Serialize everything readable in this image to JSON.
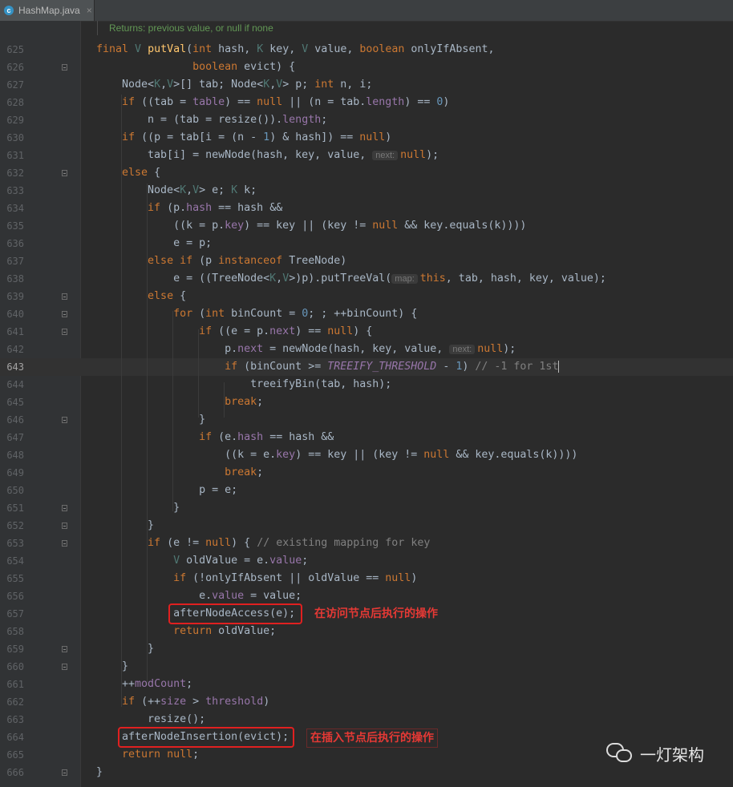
{
  "tab": {
    "title": "HashMap.java",
    "icon": "java-class-icon",
    "close": "×"
  },
  "doc_comment": "Returns: previous value, or null if none",
  "lines": [
    {
      "n": "625",
      "fold": false,
      "html": "<span class=\"kw\">final </span><span class=\"tp\">V</span> <span class=\"fn\">putVal</span>(<span class=\"kw\">int </span>hash, <span class=\"tp\">K</span> key, <span class=\"tp\">V</span> value, <span class=\"kw\">boolean </span>onlyIfAbsent,"
    },
    {
      "n": "626",
      "fold": true,
      "html": "               <span class=\"kw\">boolean </span>evict) {"
    },
    {
      "n": "627",
      "fold": false,
      "html": "    Node&lt;<span class=\"tp\">K</span>,<span class=\"tp\">V</span>&gt;[] tab; Node&lt;<span class=\"tp\">K</span>,<span class=\"tp\">V</span>&gt; p; <span class=\"kw\">int </span>n, i;"
    },
    {
      "n": "628",
      "fold": false,
      "html": "    <span class=\"kw\">if </span>((tab = <span class=\"fld\">table</span>) == <span class=\"kw\">null </span>|| (n = tab.<span class=\"fld\">length</span>) == <span class=\"num\">0</span>)"
    },
    {
      "n": "629",
      "fold": false,
      "html": "        n = (tab = resize()).<span class=\"fld\">length</span>;"
    },
    {
      "n": "630",
      "fold": false,
      "html": "    <span class=\"kw\">if </span>((p = tab[i = (n - <span class=\"num\">1</span>) &amp; hash]) == <span class=\"kw\">null</span>)"
    },
    {
      "n": "631",
      "fold": false,
      "html": "        tab[i] = newNode(hash, key, value, <span class=\"hint\">next:</span><span class=\"kw\">null</span>);"
    },
    {
      "n": "632",
      "fold": true,
      "html": "    <span class=\"kw\">else </span>{"
    },
    {
      "n": "633",
      "fold": false,
      "html": "        Node&lt;<span class=\"tp\">K</span>,<span class=\"tp\">V</span>&gt; e; <span class=\"tp\">K</span> k;"
    },
    {
      "n": "634",
      "fold": false,
      "html": "        <span class=\"kw\">if </span>(p.<span class=\"fld\">hash</span> == hash &amp;&amp;"
    },
    {
      "n": "635",
      "fold": false,
      "html": "            ((k = p.<span class=\"fld\">key</span>) == key || (key != <span class=\"kw\">null </span>&amp;&amp; key.equals(k))))"
    },
    {
      "n": "636",
      "fold": false,
      "html": "            e = p;"
    },
    {
      "n": "637",
      "fold": false,
      "html": "        <span class=\"kw\">else if </span>(p <span class=\"kw\">instanceof </span>TreeNode)"
    },
    {
      "n": "638",
      "fold": false,
      "html": "            e = ((TreeNode&lt;<span class=\"tp\">K</span>,<span class=\"tp\">V</span>&gt;)p).putTreeVal(<span class=\"hint\">map:</span><span class=\"kw\">this</span>, tab, hash, key, value);"
    },
    {
      "n": "639",
      "fold": true,
      "html": "        <span class=\"kw\">else </span>{"
    },
    {
      "n": "640",
      "fold": true,
      "html": "            <span class=\"kw\">for </span>(<span class=\"kw\">int </span>binCount = <span class=\"num\">0</span>; ; ++binCount) {"
    },
    {
      "n": "641",
      "fold": true,
      "html": "                <span class=\"kw\">if </span>((e = p.<span class=\"fld\">next</span>) == <span class=\"kw\">null</span>) {"
    },
    {
      "n": "642",
      "fold": false,
      "html": "                    p.<span class=\"fld\">next</span> = newNode(hash, key, value, <span class=\"hint\">next:</span><span class=\"kw\">null</span>);"
    },
    {
      "n": "643",
      "fold": false,
      "current": true,
      "html": "                    <span class=\"kw\">if </span>(binCount &gt;= <span class=\"cst\">TREEIFY_THRESHOLD</span> - <span class=\"num\">1</span>) <span class=\"cm\">// -1 for 1st</span><span class=\"caret\"></span>"
    },
    {
      "n": "644",
      "fold": false,
      "html": "                        treeifyBin(tab, hash);"
    },
    {
      "n": "645",
      "fold": false,
      "html": "                    <span class=\"kw\">break</span>;"
    },
    {
      "n": "646",
      "fold": true,
      "html": "                }"
    },
    {
      "n": "647",
      "fold": false,
      "html": "                <span class=\"kw\">if </span>(e.<span class=\"fld\">hash</span> == hash &amp;&amp;"
    },
    {
      "n": "648",
      "fold": false,
      "html": "                    ((k = e.<span class=\"fld\">key</span>) == key || (key != <span class=\"kw\">null </span>&amp;&amp; key.equals(k))))"
    },
    {
      "n": "649",
      "fold": false,
      "html": "                    <span class=\"kw\">break</span>;"
    },
    {
      "n": "650",
      "fold": false,
      "html": "                p = e;"
    },
    {
      "n": "651",
      "fold": true,
      "html": "            }"
    },
    {
      "n": "652",
      "fold": true,
      "html": "        }"
    },
    {
      "n": "653",
      "fold": true,
      "html": "        <span class=\"kw\">if </span>(e != <span class=\"kw\">null</span>) { <span class=\"cm\">// existing mapping for key</span>"
    },
    {
      "n": "654",
      "fold": false,
      "html": "            <span class=\"tp\">V</span> oldValue = e.<span class=\"fld\">value</span>;"
    },
    {
      "n": "655",
      "fold": false,
      "html": "            <span class=\"kw\">if </span>(!onlyIfAbsent || oldValue == <span class=\"kw\">null</span>)"
    },
    {
      "n": "656",
      "fold": false,
      "html": "                e.<span class=\"fld\">value</span> = value;"
    },
    {
      "n": "657",
      "fold": false,
      "html": "            afterNodeAccess(e);"
    },
    {
      "n": "658",
      "fold": false,
      "html": "            <span class=\"kw\">return </span>oldValue;"
    },
    {
      "n": "659",
      "fold": true,
      "html": "        }"
    },
    {
      "n": "660",
      "fold": true,
      "html": "    }"
    },
    {
      "n": "661",
      "fold": false,
      "html": "    ++<span class=\"fld\">modCount</span>;"
    },
    {
      "n": "662",
      "fold": false,
      "html": "    <span class=\"kw\">if </span>(++<span class=\"fld\">size</span> &gt; <span class=\"fld\">threshold</span>)"
    },
    {
      "n": "663",
      "fold": false,
      "html": "        resize();"
    },
    {
      "n": "664",
      "fold": false,
      "html": "    afterNodeInsertion(evict);"
    },
    {
      "n": "665",
      "fold": false,
      "html": "    <span class=\"kw\">return null</span>;"
    },
    {
      "n": "666",
      "fold": true,
      "html": "}"
    }
  ],
  "annotations": {
    "access": "在访问节点后执行的操作",
    "insertion": "在插入节点后执行的操作"
  },
  "watermark": {
    "text": "一灯架构",
    "icon": "wechat-icon"
  },
  "colors": {
    "background": "#2b2b2b",
    "keyword": "#cc7832",
    "method": "#ffc66d",
    "field": "#9876aa",
    "number": "#6897bb",
    "annotation_red": "#e02020"
  }
}
